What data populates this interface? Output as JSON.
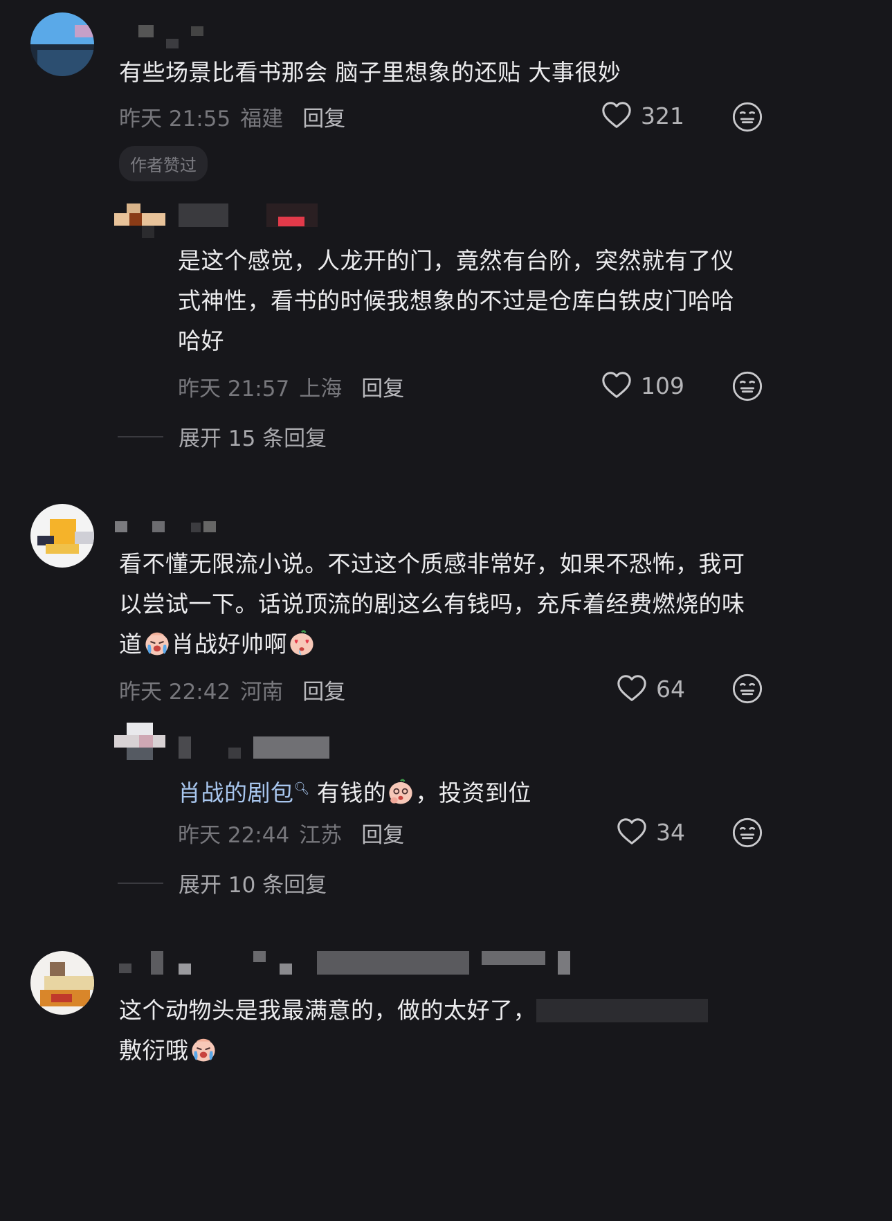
{
  "comments": [
    {
      "text": "有些场景比看书那会 脑子里想象的还贴 大事很妙",
      "time": "昨天 21:55",
      "location": "福建",
      "reply_label": "回复",
      "likes": "321",
      "badge": "作者赞过",
      "replies": [
        {
          "text": "是这个感觉，人龙开的门，竟然有台阶，突然就有了仪式神性，看书的时候我想象的不过是仓库白铁皮门哈哈哈好",
          "time": "昨天 21:57",
          "location": "上海",
          "reply_label": "回复",
          "likes": "109"
        }
      ],
      "expand_label": "展开 15 条回复"
    },
    {
      "text_a": "看不懂无限流小说。不过这个质感非常好，如果不恐怖，我可以尝试一下。话说顶流的剧这么有钱吗，充斥着经费燃烧的味道",
      "text_b": "肖战好帅啊",
      "time": "昨天 22:42",
      "location": "河南",
      "reply_label": "回复",
      "likes": "64",
      "replies": [
        {
          "link_text": "肖战的剧包",
          "text_a": "有钱的",
          "text_b": "，投资到位",
          "time": "昨天 22:44",
          "location": "江苏",
          "reply_label": "回复",
          "likes": "34"
        }
      ],
      "expand_label": "展开 10 条回复"
    },
    {
      "text_a": "这个动物头是我最满意的，做的太好了，",
      "text_b": "敷衍哦"
    }
  ],
  "icons": {
    "like": "heart-outline-icon",
    "react": "neutral-face-icon",
    "link_search": "search-icon",
    "emojis": [
      "crying-face-emoji",
      "heart-eyes-emoji",
      "drooling-face-emoji",
      "crying-face-emoji"
    ]
  },
  "colors": {
    "background": "#17171b",
    "text": "#ececee",
    "meta": "#77777c",
    "link": "#a8c6ee"
  }
}
